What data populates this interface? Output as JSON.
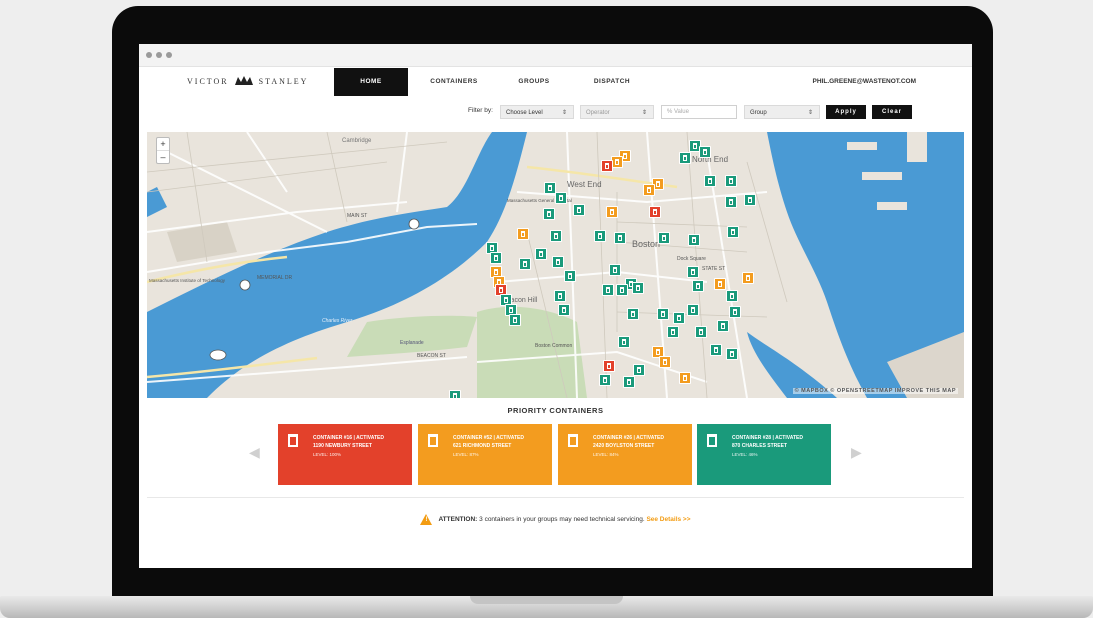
{
  "nav": {
    "logo_left": "VICTOR",
    "logo_right": "STANLEY",
    "items": [
      "HOME",
      "CONTAINERS",
      "GROUPS",
      "DISPATCH"
    ],
    "user": "PHIL.GREENE@WASTENOT.COM"
  },
  "filters": {
    "label": "Filter by:",
    "level": "Choose Level",
    "operator": "Operator",
    "value_placeholder": "% Value",
    "group": "Group",
    "apply": "Apply",
    "clear": "Clear"
  },
  "map": {
    "zoom_in": "+",
    "zoom_out": "–",
    "attribution": "© MAPBOX  © OPENSTREETMAP  IMPROVE THIS MAP",
    "labels": [
      "Cambridge",
      "West End",
      "North End",
      "Boston",
      "Beacon Hill",
      "Boston Common",
      "Dock Square",
      "Charles River",
      "Esplanade",
      "MAIN ST",
      "MEMORIAL DR",
      "BEACON ST",
      "STATE ST",
      "Massachusetts General Hospital",
      "Massachusetts Institute of Technology"
    ],
    "marker_colors": {
      "ok": "#1a9a7b",
      "warn": "#f39c1f",
      "full": "#e3412b"
    }
  },
  "priority": {
    "title": "PRIORITY CONTAINERS",
    "cards": [
      {
        "line1": "CONTAINER #16 | ACTIVATED",
        "line2": "1190 NEWBURY STREET",
        "line3": "LEVEL: 100%",
        "color": "#e3412b"
      },
      {
        "line1": "CONTAINER #52 | ACTIVATED",
        "line2": "621 RICHMOND STREET",
        "line3": "LEVEL: 87%",
        "color": "#f39c1f"
      },
      {
        "line1": "CONTAINER #26 | ACTIVATED",
        "line2": "2420 BOYLSTON STREET",
        "line3": "LEVEL: 84%",
        "color": "#f39c1f"
      },
      {
        "line1": "CONTAINER #28 | ACTIVATED",
        "line2": "870 CHARLES STREET",
        "line3": "LEVEL: 46%",
        "color": "#1a9a7b"
      }
    ]
  },
  "attention": {
    "label": "ATTENTION:",
    "message": " 3 containers in your groups may need technical servicing. ",
    "link": "See Details >>"
  }
}
